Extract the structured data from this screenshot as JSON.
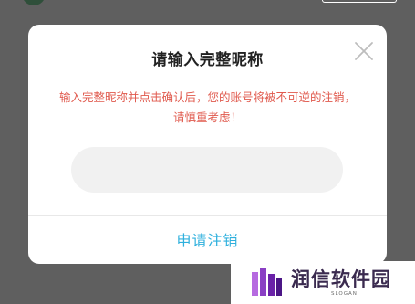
{
  "dialog": {
    "title": "请输入完整昵称",
    "warning": "输入完整昵称并点击确认后，您的账号将被不可逆的注销，请慎重考虑！",
    "input_value": "",
    "input_placeholder": "",
    "submit_label": "申请注销",
    "close_icon": "close-icon"
  },
  "watermark": {
    "text": "润信软件园",
    "slogan": "SLOGAN"
  },
  "colors": {
    "overlay": "#5f5f5f",
    "warning": "#e05a4e",
    "accent": "#2fb0dd",
    "input_bg": "#f1f1f1",
    "logo": "#7b2fb8"
  }
}
